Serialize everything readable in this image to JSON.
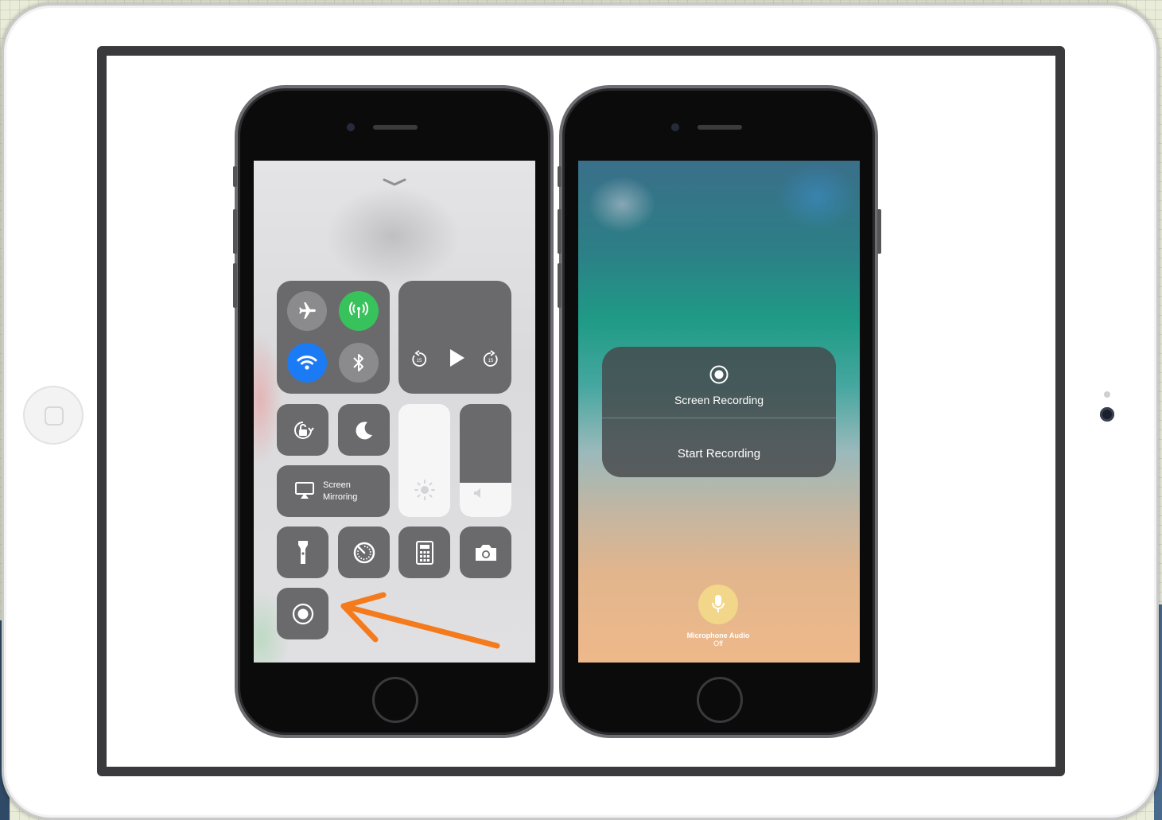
{
  "control_center": {
    "screen_mirroring_label_line1": "Screen",
    "screen_mirroring_label_line2": "Mirroring",
    "connectivity": {
      "airplane_mode": false,
      "cellular_data": true,
      "wifi": true,
      "bluetooth": false
    },
    "brightness_level": 0,
    "volume_level": 0.3
  },
  "screen_recording_panel": {
    "title": "Screen Recording",
    "action": "Start Recording"
  },
  "microphone": {
    "label": "Microphone Audio",
    "status": "Off"
  },
  "colors": {
    "arrow": "#f57a1c",
    "wifi_active": "#1b7bf4",
    "cellular_active": "#37c25b",
    "tile": "#6a6a6c"
  }
}
